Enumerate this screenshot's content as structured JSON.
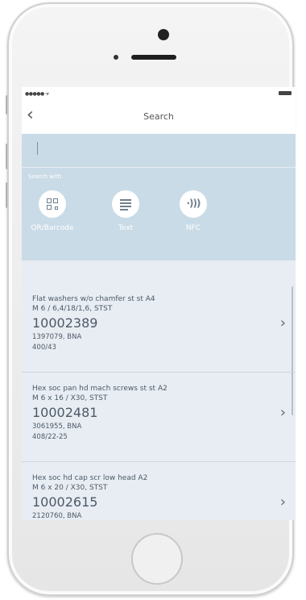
{
  "status": {
    "signal": "●●●●● ",
    "wifi": "ᯤ"
  },
  "nav": {
    "back": "‹",
    "title": "Search"
  },
  "search": {
    "caret": "|",
    "search_with": "Search with"
  },
  "options": [
    {
      "label": "QR/Barcode",
      "icon": "qr-code-icon"
    },
    {
      "label": "Text",
      "icon": "text-lines-icon"
    },
    {
      "label": "NFC",
      "icon": "nfc-icon"
    }
  ],
  "nfc_glyph": "·)))",
  "items": [
    {
      "name": "Flat washers w/o chamfer st st A4",
      "spec": "M 6 / 6,4/18/1,6, STST",
      "number": "10002389",
      "line1": "1397079, BNA",
      "line2": "400/43",
      "chevron": "›"
    },
    {
      "name": "Hex soc pan hd mach screws st st A2",
      "spec": "M 6 x 16 / X30, STST",
      "number": "10002481",
      "line1": "3061955, BNA",
      "line2": "408/22-25",
      "chevron": "›"
    },
    {
      "name": "Hex soc hd cap scr low head A2",
      "spec": "M 6 x 20 / X30, STST",
      "number": "10002615",
      "line1": "2120760, BNA",
      "line2": "",
      "chevron": "›"
    }
  ]
}
